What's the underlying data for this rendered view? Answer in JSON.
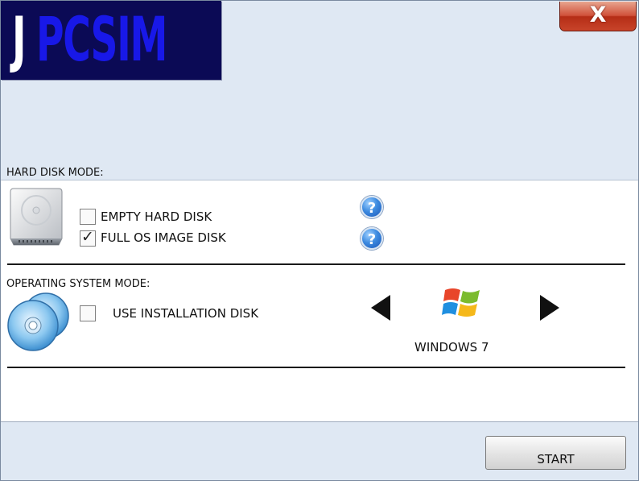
{
  "header": {
    "logo_j": "J",
    "logo_rest": "PCSIM",
    "close_label": "X"
  },
  "hard_disk": {
    "section_title": "HARD DISK MODE:",
    "options": [
      {
        "label": "EMPTY HARD DISK",
        "checked": false
      },
      {
        "label": "FULL OS IMAGE DISK",
        "checked": true
      }
    ],
    "help_label": "?"
  },
  "os_mode": {
    "section_title": "OPERATING SYSTEM MODE:",
    "use_install_disk": {
      "label": "USE INSTALLATION DISK",
      "checked": false
    },
    "selected_os": "WINDOWS 7"
  },
  "footer": {
    "start_label": "START"
  },
  "colors": {
    "logo_bg": "#0b0a55",
    "logo_blue": "#1818e8",
    "window_bg": "#dfe8f3",
    "close_red": "#c8442a"
  },
  "icons": [
    "hard-disk-icon",
    "help-icon",
    "cd-disks-icon",
    "windows-logo-icon",
    "arrow-left-icon",
    "arrow-right-icon",
    "close-icon",
    "checkmark-icon"
  ]
}
